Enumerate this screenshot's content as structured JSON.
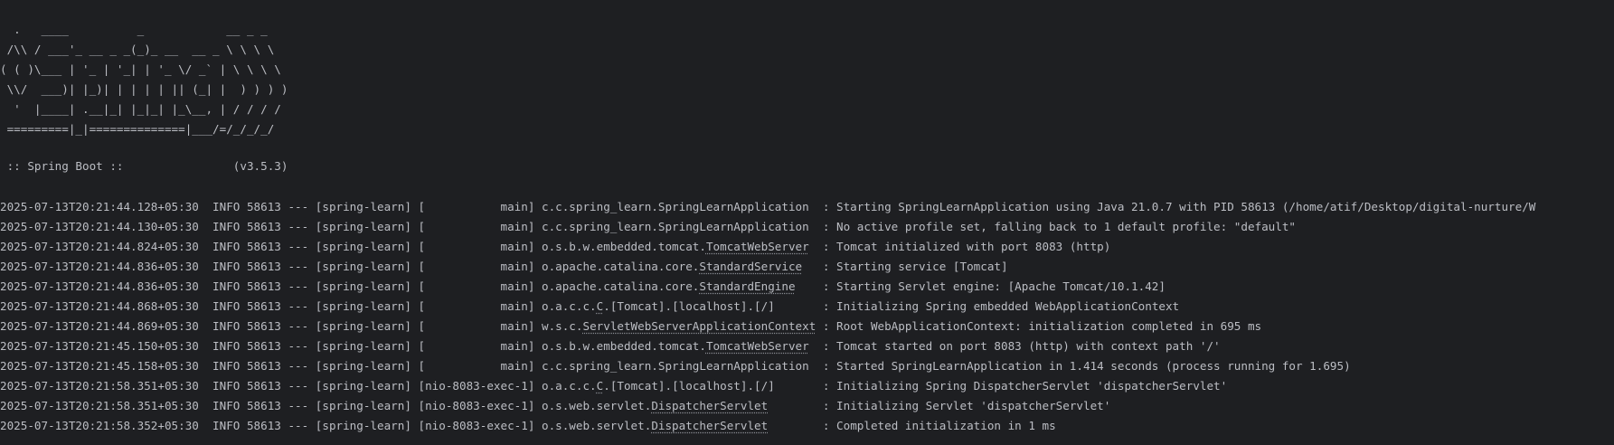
{
  "banner": [
    "  .   ____          _            __ _ _",
    " /\\\\ / ___'_ __ _ _(_)_ __  __ _ \\ \\ \\ \\",
    "( ( )\\___ | '_ | '_| | '_ \\/ _` | \\ \\ \\ \\",
    " \\\\/  ___)| |_)| | | | | || (_| |  ) ) ) )",
    "  '  |____| .__|_| |_|_| |_\\__, | / / / /",
    " =========|_|==============|___/=/_/_/_/"
  ],
  "spring_boot_line": " :: Spring Boot ::                (v3.5.3)",
  "logs": [
    {
      "pre": "2025-07-13T20:21:44.128+05:30  INFO 58613 --- [spring-learn] [           main] c.c.spring_learn.SpringLearnApplication  : Starting SpringLearnApplication using Java 21.0.7 with PID 58613 (/home/atif/Desktop/digital-nurture/W",
      "u": "",
      "post": ""
    },
    {
      "pre": "2025-07-13T20:21:44.130+05:30  INFO 58613 --- [spring-learn] [           main] c.c.spring_learn.SpringLearnApplication  : No active profile set, falling back to 1 default profile: \"default\"",
      "u": "",
      "post": ""
    },
    {
      "pre": "2025-07-13T20:21:44.824+05:30  INFO 58613 --- [spring-learn] [           main] o.s.b.w.embedded.tomcat.",
      "u": "TomcatWebServer",
      "post": "  : Tomcat initialized with port 8083 (http)"
    },
    {
      "pre": "2025-07-13T20:21:44.836+05:30  INFO 58613 --- [spring-learn] [           main] o.apache.catalina.core.",
      "u": "StandardService",
      "post": "   : Starting service [Tomcat]"
    },
    {
      "pre": "2025-07-13T20:21:44.836+05:30  INFO 58613 --- [spring-learn] [           main] o.apache.catalina.core.",
      "u": "StandardEngine",
      "post": "    : Starting Servlet engine: [Apache Tomcat/10.1.42]"
    },
    {
      "pre": "2025-07-13T20:21:44.868+05:30  INFO 58613 --- [spring-learn] [           main] o.a.c.c.",
      "u": "C",
      "post": ".[Tomcat].[localhost].[/]       : Initializing Spring embedded WebApplicationContext"
    },
    {
      "pre": "2025-07-13T20:21:44.869+05:30  INFO 58613 --- [spring-learn] [           main] w.s.c.",
      "u": "ServletWebServerApplicationContext",
      "post": " : Root WebApplicationContext: initialization completed in 695 ms"
    },
    {
      "pre": "2025-07-13T20:21:45.150+05:30  INFO 58613 --- [spring-learn] [           main] o.s.b.w.embedded.tomcat.",
      "u": "TomcatWebServer",
      "post": "  : Tomcat started on port 8083 (http) with context path '/'"
    },
    {
      "pre": "2025-07-13T20:21:45.158+05:30  INFO 58613 --- [spring-learn] [           main] c.c.spring_learn.SpringLearnApplication  : Started SpringLearnApplication in 1.414 seconds (process running for 1.695)",
      "u": "",
      "post": ""
    },
    {
      "pre": "2025-07-13T20:21:58.351+05:30  INFO 58613 --- [spring-learn] [nio-8083-exec-1] o.a.c.c.",
      "u": "C",
      "post": ".[Tomcat].[localhost].[/]       : Initializing Spring DispatcherServlet 'dispatcherServlet'"
    },
    {
      "pre": "2025-07-13T20:21:58.351+05:30  INFO 58613 --- [spring-learn] [nio-8083-exec-1] o.s.web.servlet.",
      "u": "DispatcherServlet",
      "post": "        : Initializing Servlet 'dispatcherServlet'"
    },
    {
      "pre": "2025-07-13T20:21:58.352+05:30  INFO 58613 --- [spring-learn] [nio-8083-exec-1] o.s.web.servlet.",
      "u": "DispatcherServlet",
      "post": "        : Completed initialization in 1 ms"
    }
  ]
}
